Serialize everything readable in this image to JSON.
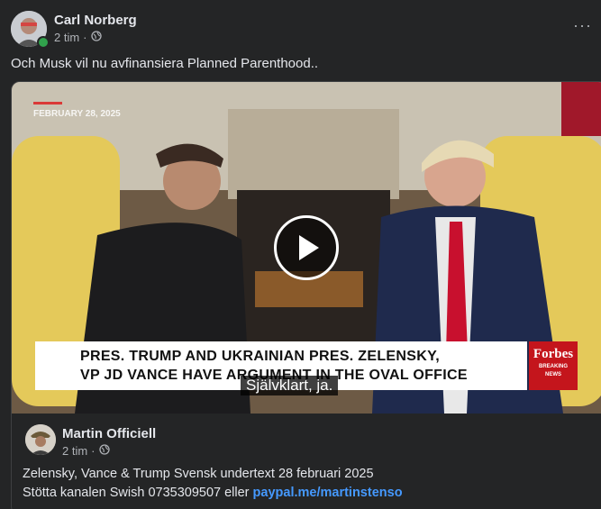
{
  "post": {
    "author": "Carl Norberg",
    "time": "2 tim",
    "separator": "·",
    "text": "Och Musk vil nu avfinansiera Planned Parenthood..",
    "more_label": "···"
  },
  "video": {
    "date_tag": "FEBRUARY 28, 2025",
    "chyron_line1": "PRES. TRUMP AND UKRAINIAN PRES. ZELENSKY,",
    "chyron_line2": "VP JD VANCE HAVE ARGUMENT IN THE OVAL OFFICE",
    "brand": "Forbes",
    "brand_sub1": "BREAKING",
    "brand_sub2": "NEWS",
    "subtitle": "Självklart, ja."
  },
  "shared": {
    "author": "Martin Officiell",
    "time": "2 tim",
    "separator": "·",
    "desc_line1": "Zelensky, Vance & Trump Svensk undertext 28 februari 2025",
    "desc_line2_prefix": "Stötta kanalen Swish 0735309507 eller ",
    "link_text": "paypal.me/martinstenso"
  },
  "icons": [
    "globe-icon",
    "play-icon",
    "more-icon",
    "online-status-icon"
  ],
  "colors": {
    "background": "#242526",
    "link": "#4599ff",
    "online": "#31a24c",
    "forbes_red": "#c4151c"
  }
}
